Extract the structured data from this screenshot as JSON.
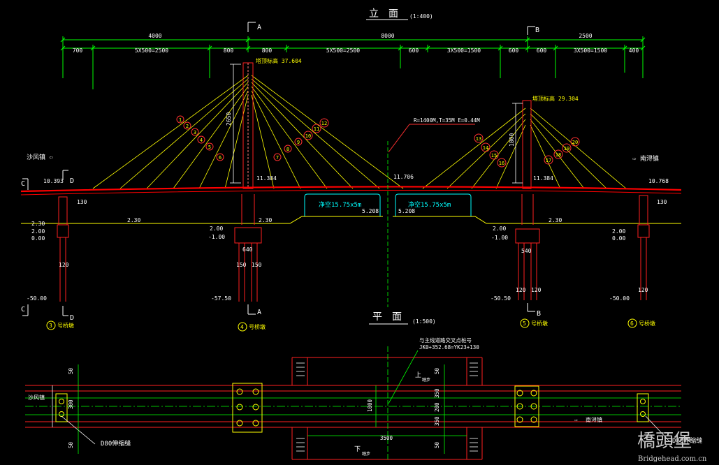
{
  "titles": {
    "elevation": "立　面",
    "elevation_scale": "(1:400)",
    "plan": "平　面",
    "plan_scale": "(1:500)"
  },
  "section_marks": {
    "a": "A",
    "b": "B",
    "c": "C",
    "d": "D"
  },
  "dimensions_top": {
    "overall": [
      "4000",
      "8000",
      "2500"
    ],
    "segments": [
      "700",
      "5X500=2500",
      "800",
      "800",
      "5X500=2500",
      "600",
      "3X500=1500",
      "600",
      "600",
      "3X500=1500",
      "400"
    ]
  },
  "tower_labels": {
    "a_top": "塔顶标高 37.604",
    "b_top": "塔顶标高 29.304",
    "a_height": "2650",
    "b_height": "1800"
  },
  "cable_numbers": [
    "1",
    "2",
    "3",
    "4",
    "5",
    "6",
    "7",
    "8",
    "9",
    "10",
    "11",
    "12",
    "13",
    "14",
    "15",
    "16",
    "17",
    "18",
    "19",
    "20"
  ],
  "curve_note": "R=1400M,T=35M E=0.44M",
  "elevations": {
    "deck_left": "10.393",
    "deck_a": "11.384",
    "deck_mid": "11.706",
    "deck_b": "11.384",
    "deck_right": "10.768",
    "water_a": "2.30",
    "water_b": "2.30",
    "water_c": "2.30",
    "water_d": "2.30",
    "ground_left_1": "2.00",
    "ground_left_2": "0.00",
    "ground_a_1": "2.00",
    "ground_a_2": "-1.00",
    "ground_b_1": "2.00",
    "ground_b_2": "-1.00",
    "ground_right_1": "2.00",
    "ground_right_2": "0.00",
    "pile_left": "-50.00",
    "pile_a": "-57.50",
    "pile_b": "-50.50",
    "pile_right": "-50.00",
    "clear_left_val": "5.208",
    "clear_right_val": "5.208"
  },
  "clearance": {
    "left": "净空15.75x5m",
    "right": "净空15.75x5m"
  },
  "pier_dims": {
    "left_130": "130",
    "left_120": "120",
    "a_640": "640",
    "a_150_1": "150",
    "a_150_2": "150",
    "b_540": "540",
    "b_120_1": "120",
    "b_120_2": "120",
    "right_130": "130",
    "right_120": "120"
  },
  "directions": {
    "left": "沙风镇 ⇦",
    "right": "⇨ 南浔镇"
  },
  "piers": {
    "p3_num": "3",
    "p3": "号桥墩",
    "p4_num": "4",
    "p4": "号桥墩",
    "p5_num": "5",
    "p5": "号桥墩",
    "p6_num": "6",
    "p6": "号桥墩"
  },
  "plan": {
    "note1": "与主线道路交叉点桩号",
    "note2": "JK0+352.68=YK23+130",
    "left_town": "沙风镇",
    "right_town": "南浔镇",
    "joint_left": "D80伸缩缝",
    "joint_right": "D80伸缩缝",
    "dim_50_a": "50",
    "dim_50_b": "50",
    "dim_50_c": "50",
    "dim_50_d": "50",
    "dim_300": "300",
    "dim_1000": "1000",
    "dim_350_top": "350",
    "dim_200": "200",
    "dim_350_bot": "350",
    "dim_3500": "3500",
    "ramp_up": "上",
    "ramp_down": "下",
    "ramp_word": "踏步"
  },
  "watermark": {
    "logo": "橋頭堡",
    "site": "Bridgehead.com.cn"
  },
  "colors": {
    "bg": "#000000",
    "deck": "#ff0000",
    "cable": "#ffff00",
    "dimension": "#00ff00",
    "clearance": "#00ffff",
    "text": "#ffffff"
  }
}
